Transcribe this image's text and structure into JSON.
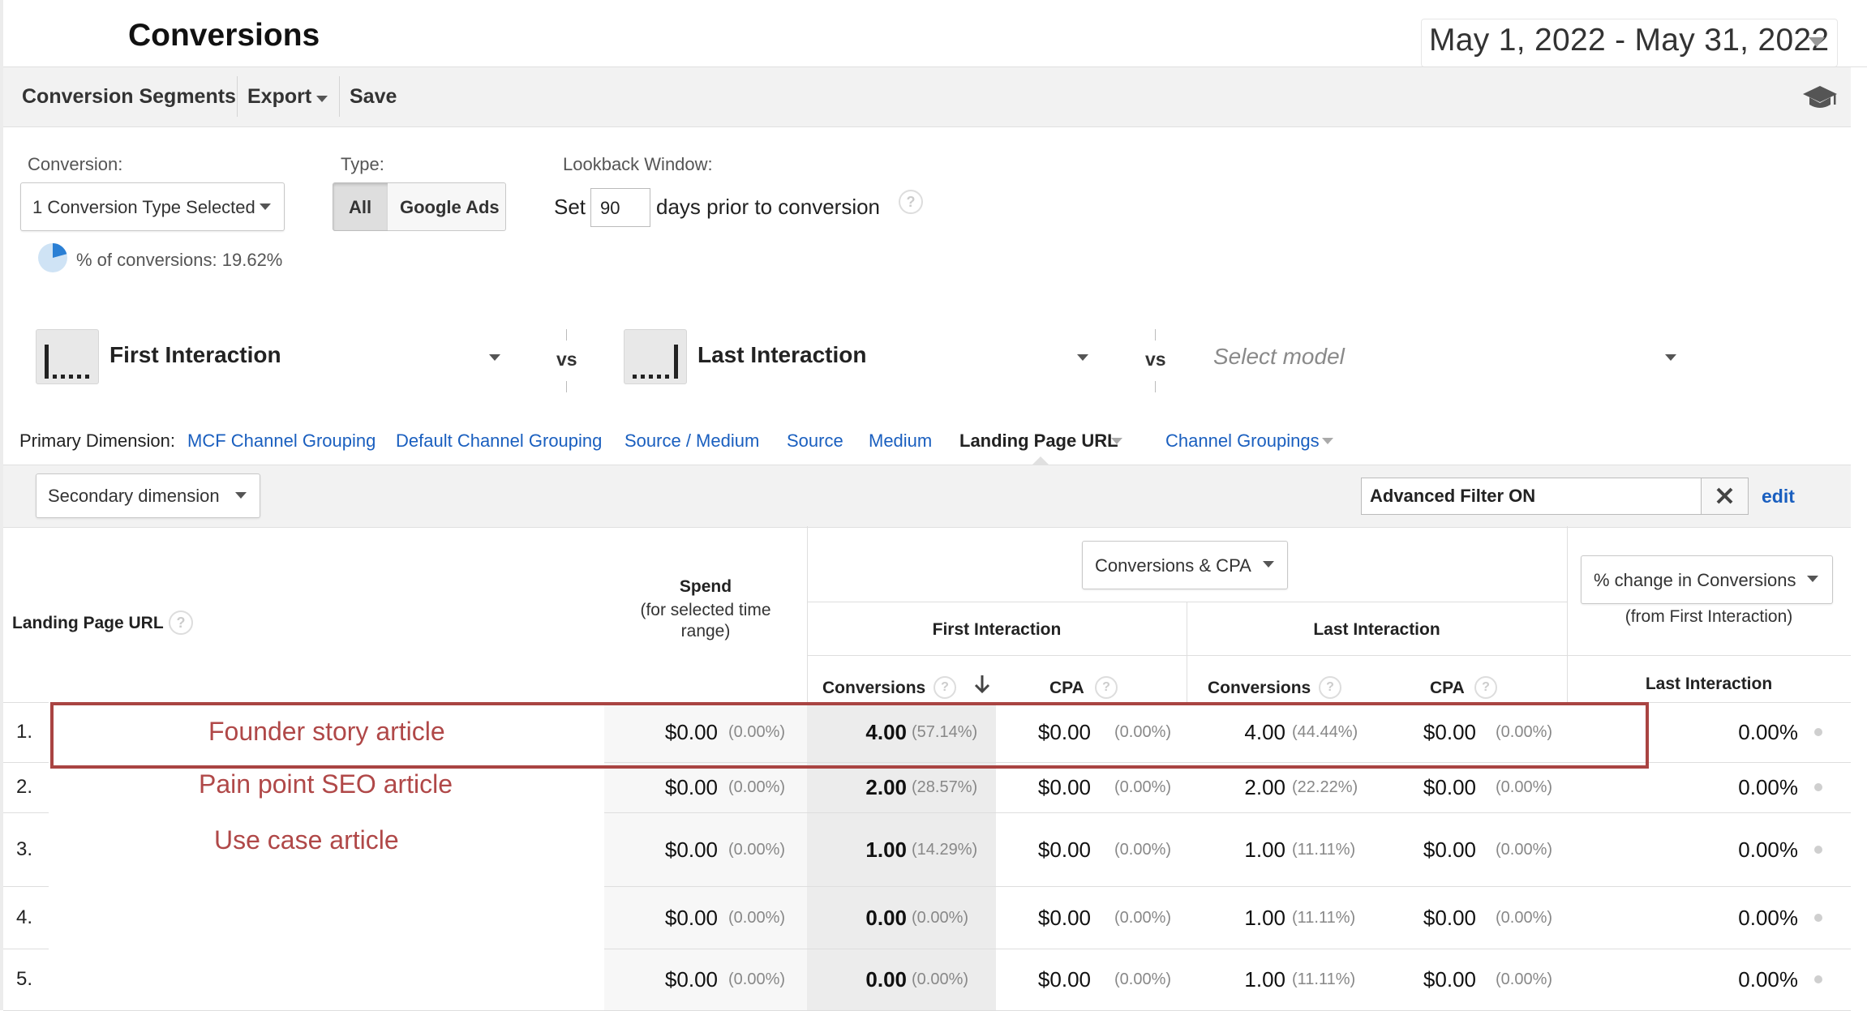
{
  "header": {
    "title": "Conversions",
    "date_range": "May 1, 2022 - May 31, 2022"
  },
  "toolbar": {
    "segments_label": "Conversion Segments",
    "export_label": "Export",
    "save_label": "Save",
    "help_icon": "graduation-cap-icon"
  },
  "controls": {
    "conversion_label": "Conversion:",
    "conversion_value": "1 Conversion Type Selected",
    "type_label": "Type:",
    "type_all": "All",
    "type_google_ads": "Google Ads",
    "lookback_label": "Lookback Window:",
    "lookback_prefix": "Set",
    "lookback_days": "90",
    "lookback_suffix": "days prior to conversion",
    "pct_conversions": "% of conversions: 19.62%",
    "pct_value": 0.1962
  },
  "models": {
    "first": "First Interaction",
    "vs": "vs",
    "last": "Last Interaction",
    "select_placeholder": "Select model"
  },
  "primary_dimension": {
    "label": "Primary Dimension:",
    "links": [
      "MCF Channel Grouping",
      "Default Channel Grouping",
      "Source / Medium",
      "Source",
      "Medium"
    ],
    "active": "Landing Page URL",
    "channel_groupings": "Channel Groupings"
  },
  "filter_bar": {
    "secondary_dimension": "Secondary dimension",
    "advanced_filter": "Advanced Filter ON",
    "edit": "edit"
  },
  "table": {
    "col_landing": "Landing Page URL",
    "spend_title": "Spend",
    "spend_sub1": "(for selected time",
    "spend_sub2": "range)",
    "metric_select": "Conversions & CPA",
    "first_interaction": "First Interaction",
    "last_interaction": "Last Interaction",
    "conversions": "Conversions",
    "cpa": "CPA",
    "change_select": "% change in Conversions",
    "change_sub": "(from First Interaction)",
    "change_col": "Last Interaction",
    "rows": [
      {
        "num": "1.",
        "spend": "$0.00",
        "spend_pct": "(0.00%)",
        "fi_conv": "4.00",
        "fi_conv_pct": "(57.14%)",
        "fi_cpa": "$0.00",
        "fi_cpa_pct": "(0.00%)",
        "li_conv": "4.00",
        "li_conv_pct": "(44.44%)",
        "li_cpa": "$0.00",
        "li_cpa_pct": "(0.00%)",
        "change": "0.00%"
      },
      {
        "num": "2.",
        "spend": "$0.00",
        "spend_pct": "(0.00%)",
        "fi_conv": "2.00",
        "fi_conv_pct": "(28.57%)",
        "fi_cpa": "$0.00",
        "fi_cpa_pct": "(0.00%)",
        "li_conv": "2.00",
        "li_conv_pct": "(22.22%)",
        "li_cpa": "$0.00",
        "li_cpa_pct": "(0.00%)",
        "change": "0.00%"
      },
      {
        "num": "3.",
        "spend": "$0.00",
        "spend_pct": "(0.00%)",
        "fi_conv": "1.00",
        "fi_conv_pct": "(14.29%)",
        "fi_cpa": "$0.00",
        "fi_cpa_pct": "(0.00%)",
        "li_conv": "1.00",
        "li_conv_pct": "(11.11%)",
        "li_cpa": "$0.00",
        "li_cpa_pct": "(0.00%)",
        "change": "0.00%"
      },
      {
        "num": "4.",
        "spend": "$0.00",
        "spend_pct": "(0.00%)",
        "fi_conv": "0.00",
        "fi_conv_pct": "(0.00%)",
        "fi_cpa": "$0.00",
        "fi_cpa_pct": "(0.00%)",
        "li_conv": "1.00",
        "li_conv_pct": "(11.11%)",
        "li_cpa": "$0.00",
        "li_cpa_pct": "(0.00%)",
        "change": "0.00%"
      },
      {
        "num": "5.",
        "spend": "$0.00",
        "spend_pct": "(0.00%)",
        "fi_conv": "0.00",
        "fi_conv_pct": "(0.00%)",
        "fi_cpa": "$0.00",
        "fi_cpa_pct": "(0.00%)",
        "li_conv": "1.00",
        "li_conv_pct": "(11.11%)",
        "li_cpa": "$0.00",
        "li_cpa_pct": "(0.00%)",
        "change": "0.00%"
      }
    ]
  },
  "annotations": {
    "row1": "Founder story article",
    "row2": "Pain point SEO article",
    "row3": "Use case article",
    "color": "#b04848"
  }
}
